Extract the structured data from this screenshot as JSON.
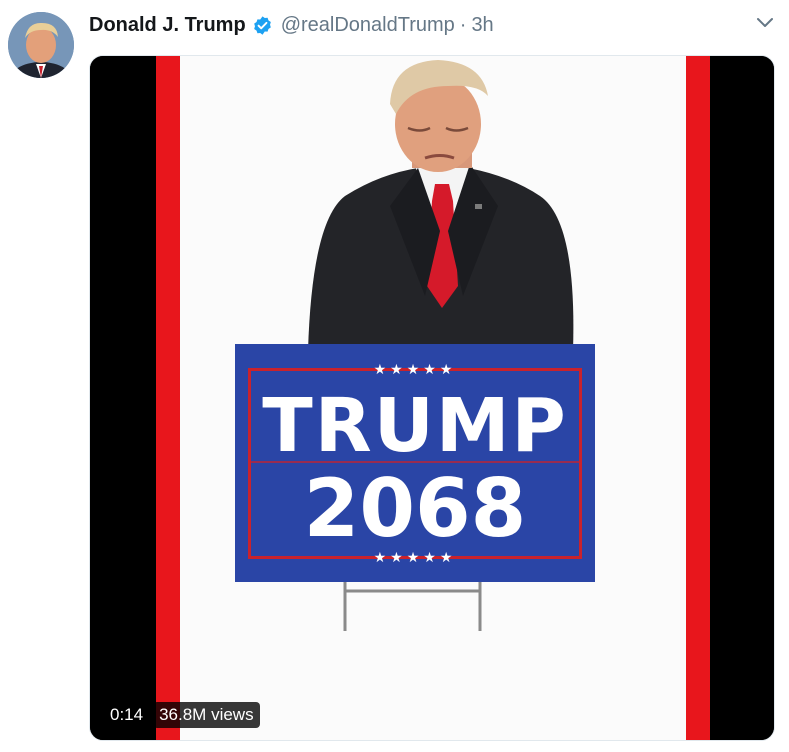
{
  "tweet": {
    "display_name": "Donald J. Trump",
    "handle": "@realDonaldTrump",
    "separator": "·",
    "time": "3h",
    "verified": true
  },
  "video": {
    "duration": "0:14",
    "views": "36.8M views",
    "sign_line1": "TRUMP",
    "sign_line2": "2068",
    "sign_stars_top": "★★★★★",
    "sign_stars_bottom": "★★★★★"
  },
  "icons": {
    "verified": "verified-badge-icon",
    "caret": "chevron-down-icon"
  },
  "colors": {
    "verified_blue": "#1da1f2",
    "sign_blue": "#2a45a6",
    "stripe_red": "#e8161c",
    "tie_red": "#d51a2a"
  }
}
